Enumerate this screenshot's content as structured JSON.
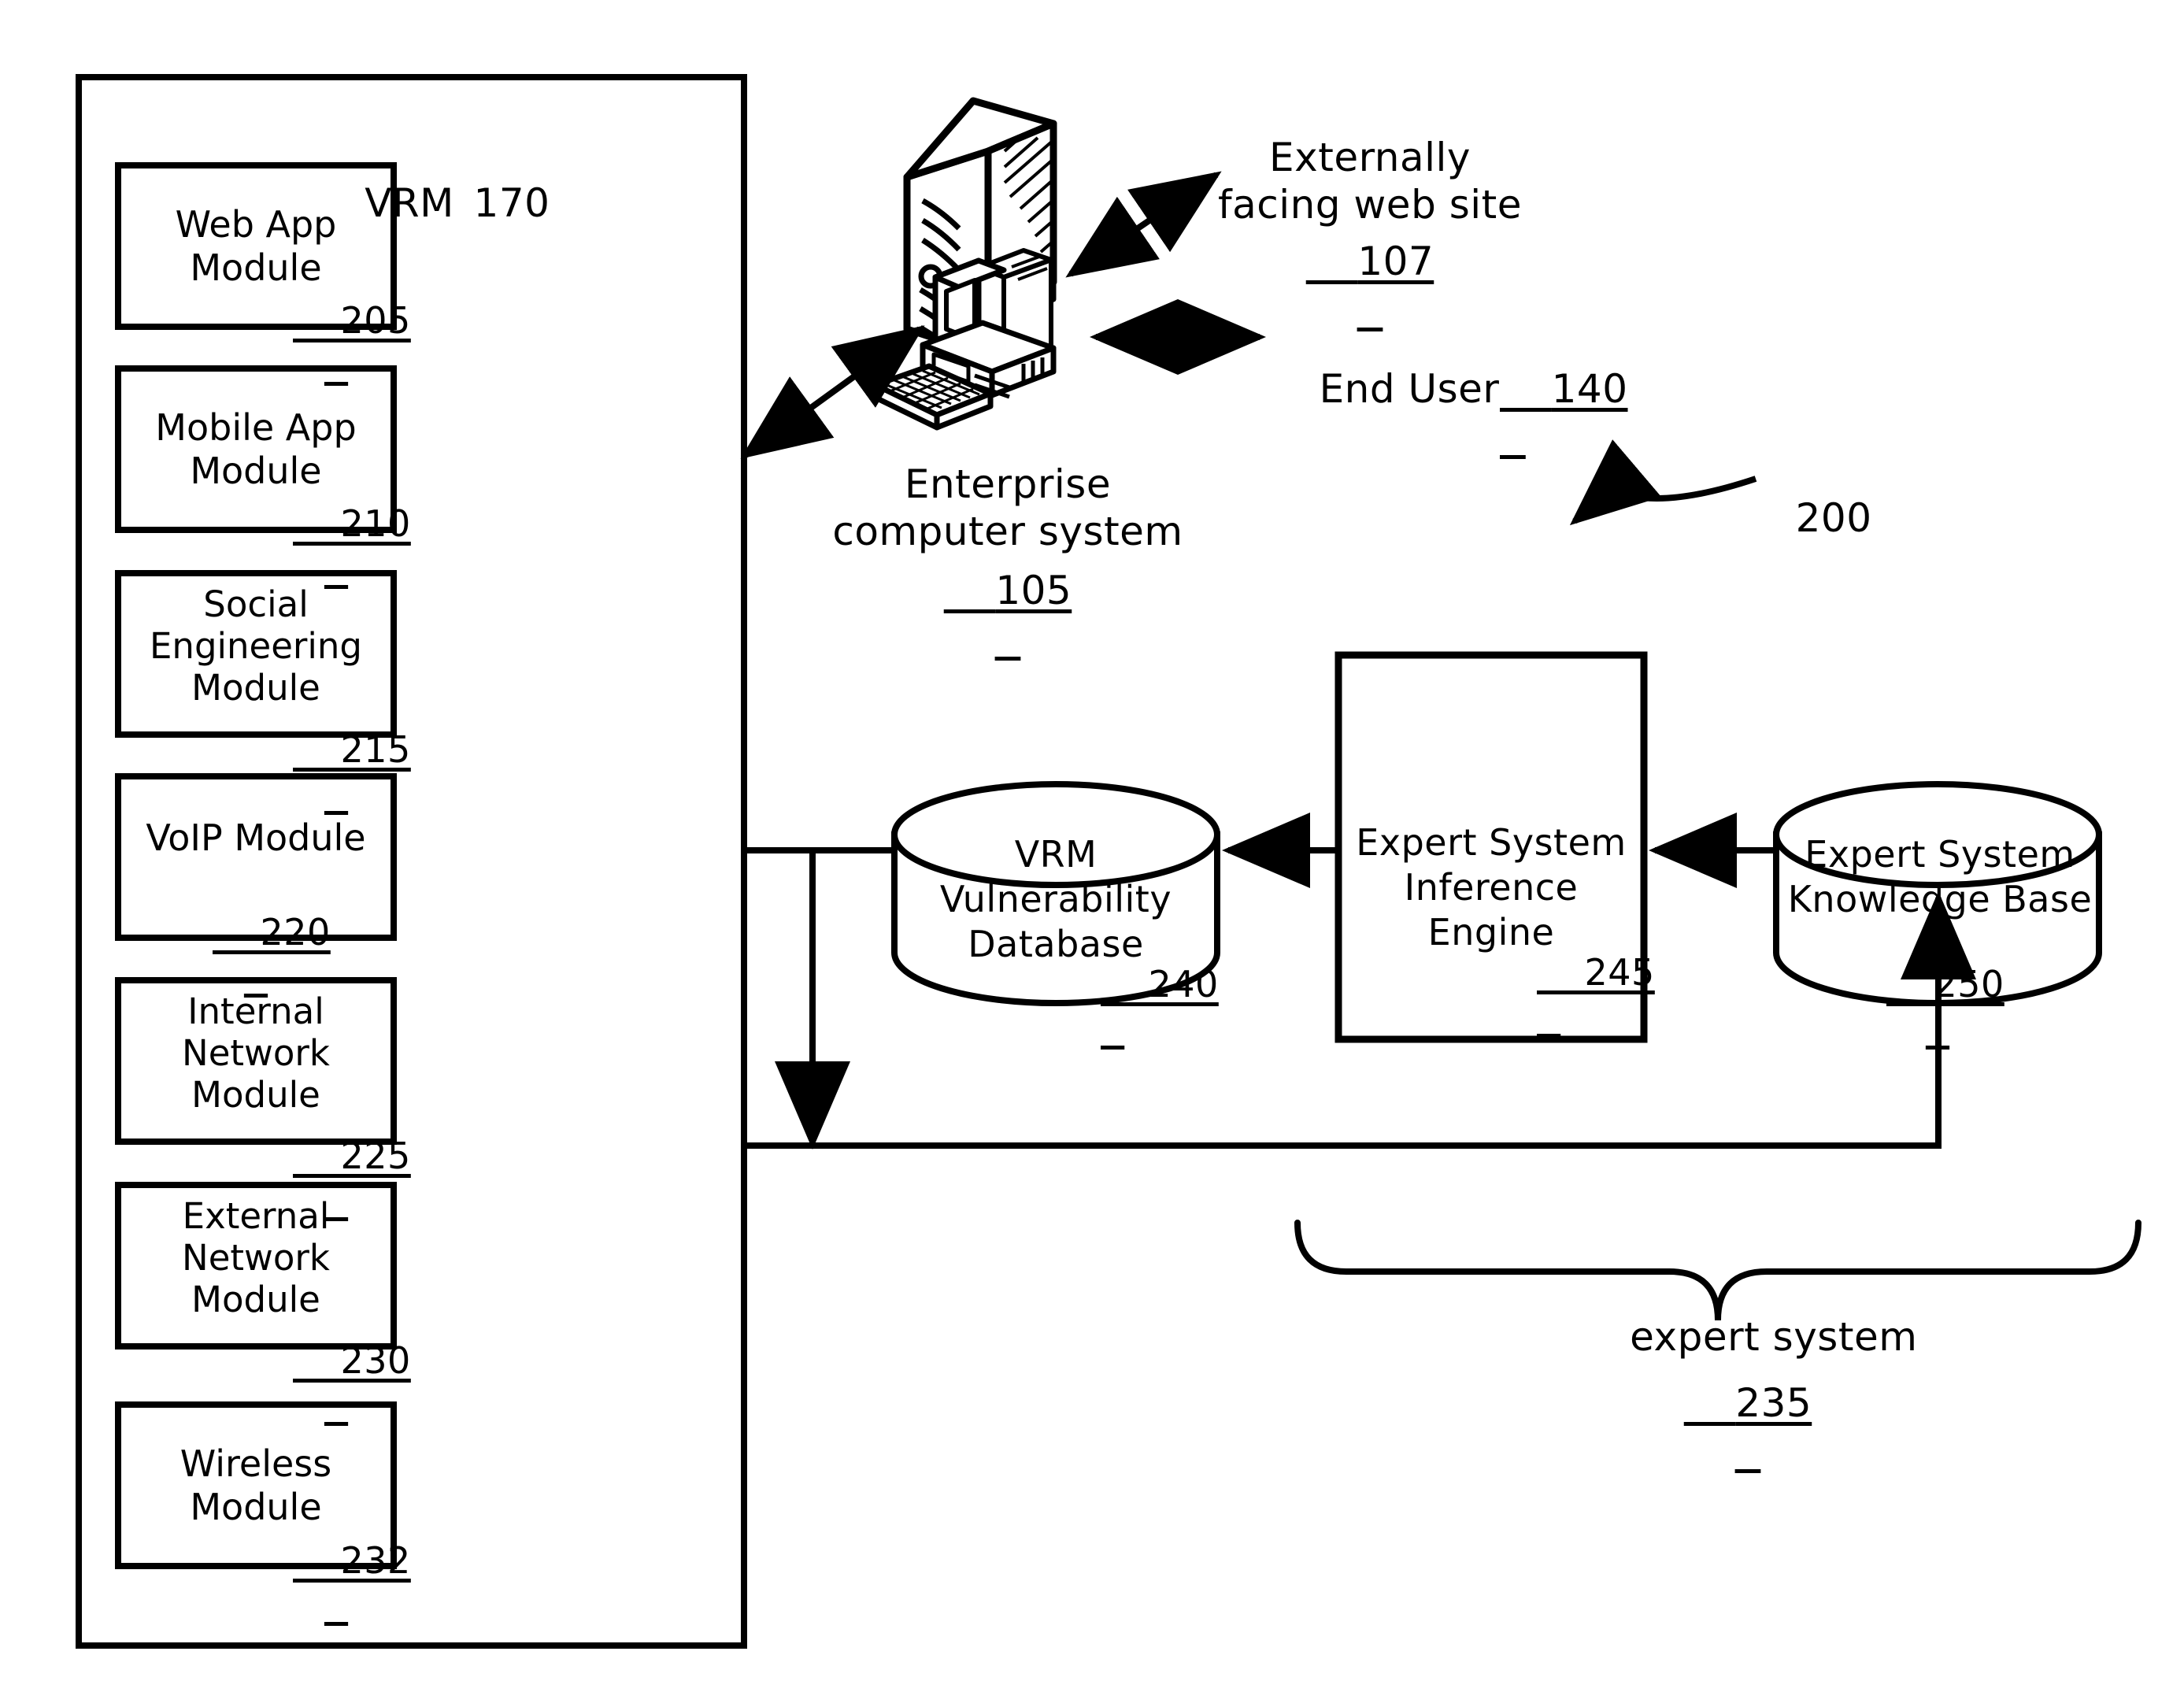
{
  "figure": {
    "reference_numeral": "200",
    "vrm_container": {
      "title": "VRM",
      "numeral": "170",
      "modules": [
        {
          "name": "Web App\nModule",
          "numeral": "205",
          "inline": true
        },
        {
          "name": "Mobile App\nModule",
          "numeral": "210",
          "inline": true
        },
        {
          "name": "Social\nEngineering\nModule",
          "numeral": "215",
          "inline": true
        },
        {
          "name": "VoIP Module",
          "numeral": "220",
          "inline": false
        },
        {
          "name": "Internal\nNetwork\nModule",
          "numeral": "225",
          "inline": true
        },
        {
          "name": "External\nNetwork\nModule",
          "numeral": "230",
          "inline": true
        },
        {
          "name": "Wireless\nModule",
          "numeral": "232",
          "inline": true
        }
      ]
    },
    "nodes": [
      {
        "id": "enterprise",
        "label": "Enterprise\ncomputer system",
        "numeral": "105",
        "shape": "computer-illustration"
      },
      {
        "id": "website",
        "label": "Externally\nfacing web site",
        "numeral": "107",
        "shape": "callout-text"
      },
      {
        "id": "enduser",
        "label": "End User",
        "numeral": "140",
        "shape": "callout-text"
      },
      {
        "id": "vrmdb",
        "label": "VRM\nVulnerability\nDatabase",
        "numeral": "240",
        "shape": "cylinder"
      },
      {
        "id": "engine",
        "label": "Expert System\nInference\nEngine",
        "numeral": "245",
        "shape": "rectangle"
      },
      {
        "id": "kb",
        "label": "Expert System\nKnowledge Base",
        "numeral": "250",
        "shape": "cylinder"
      },
      {
        "id": "expert-group",
        "label": "expert system",
        "numeral": "235",
        "shape": "brace-group"
      }
    ],
    "connectors": [
      {
        "from": "vrm-container",
        "to": "enterprise",
        "arrow": "double",
        "style": "diagonal"
      },
      {
        "from": "enterprise",
        "to": "website",
        "arrow": "double",
        "style": "diagonal"
      },
      {
        "from": "enterprise",
        "to": "enduser",
        "arrow": "double",
        "style": "horizontal"
      },
      {
        "from": "engine",
        "to": "vrmdb",
        "arrow": "single",
        "style": "horizontal"
      },
      {
        "from": "kb",
        "to": "engine",
        "arrow": "single",
        "style": "horizontal"
      },
      {
        "from": "vrm-container",
        "to": "vrmdb",
        "arrow": "none",
        "style": "horizontal"
      },
      {
        "from": "vrmdb-feed",
        "to": "bus",
        "arrow": "single-down",
        "style": "vertical"
      },
      {
        "from": "vrm-container",
        "to": "kb",
        "arrow": "single-up",
        "style": "orthogonal"
      }
    ]
  }
}
